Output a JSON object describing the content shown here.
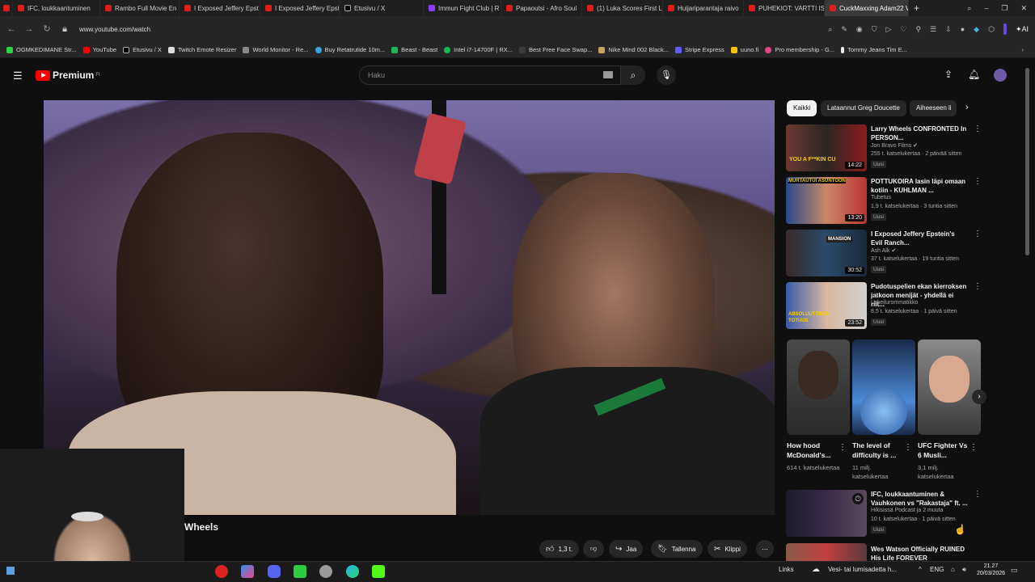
{
  "browser": {
    "tabs": [
      {
        "label": "IFC, loukkaantuminen"
      },
      {
        "label": "Rambo Full Movie En"
      },
      {
        "label": "I Exposed Jeffery Epst"
      },
      {
        "label": "I Exposed Jeffery Epst"
      },
      {
        "label": "Etusivu / X"
      },
      {
        "label": "Immun Fight Club | R"
      },
      {
        "label": "Papaoutsi - Afro Soul"
      },
      {
        "label": "(1) Luka Scores First L"
      },
      {
        "label": "Huijariparantaja raivo"
      },
      {
        "label": "PUHEKIOT: VARTTI IS"
      },
      {
        "label": "CuckMaxxing Adam22 V"
      }
    ],
    "url": "www.youtube.com/watch",
    "ai_label": "AI",
    "bookmarks": [
      {
        "label": "OGMKEDIMANE Str..."
      },
      {
        "label": "YouTube"
      },
      {
        "label": "Etusivu / X"
      },
      {
        "label": "Twitch Emote Resizer"
      },
      {
        "label": "World Monitor - Re..."
      },
      {
        "label": "Buy Retatrutide 10m..."
      },
      {
        "label": "Beast - Beast"
      },
      {
        "label": "Intel i7-14700F | RX..."
      },
      {
        "label": "Best Free Face Swap..."
      },
      {
        "label": "Nike Mind 002 Black..."
      },
      {
        "label": "Stripe Express"
      },
      {
        "label": "uuno.fi"
      },
      {
        "label": "Pro membership - G..."
      },
      {
        "label": "Tommy Jeans Tim E..."
      }
    ]
  },
  "youtube": {
    "logo": "Premium",
    "logo_sup": "FI",
    "search_placeholder": "Haku",
    "video_title": "Wheels",
    "actions": {
      "likes": "1,3 t.",
      "share": "Jaa",
      "save": "Tallenna",
      "clip": "Klippi"
    },
    "chips": [
      "Kaikki",
      "Lataannut Greg Doucette",
      "Aiheeseen li"
    ],
    "recommendations": [
      {
        "title": "Larry Wheels CONFRONTED In PERSON...",
        "channel": "Jon Bravo Films",
        "meta": "255 t. katselukertaa · 2 päivää sitten",
        "badge": "Uusi",
        "duration": "14:22",
        "thumb_text": "YOU A F**KIN CU"
      },
      {
        "title": "POTTUKOIRA lasin läpi omaan kotiin - KUHLMAN ...",
        "channel": "Tubetus",
        "meta": "1,9 t. katselukertaa · 3 tuntia sitten",
        "badge": "Uusi",
        "duration": "13:20",
        "thumb_text": "MURTAUTUI ASUNTOON"
      },
      {
        "title": "I Exposed Jeffery Epstein's Evil Ranch...",
        "channel": "Ash Alk",
        "meta": "37 t. katselukertaa · 19 tuntia sitten",
        "badge": "Uusi",
        "duration": "30:52",
        "thumb_text": "MANSION"
      },
      {
        "title": "Pudotuspelien ekan kierroksen jatkoon menijät - yhdellä ei riit...",
        "channel": "Urheilurommatikko",
        "meta": "8,5 t. katselukertaa · 1 päivä sitten",
        "badge": "Uusi",
        "duration": "23:52",
        "thumb_text": "ABSOLUUTTINEN TOTUUS"
      }
    ],
    "shorts": [
      {
        "title": "How hood McDonald's...",
        "views": "614 t. katselukertaa"
      },
      {
        "title": "The level of difficulty is ...",
        "views": "11 milj. katselukertaa"
      },
      {
        "title": "UFC Fighter Vs 6 Musli...",
        "views": "3,1 milj. katselukertaa"
      }
    ],
    "rec_bottom": [
      {
        "title": "IFC, loukkaantuminen & Vauhkonen vs \"Rakastaja\" ft. ...",
        "channel": "Hikisissä Podcast ja 2 muuta",
        "meta": "10 t. katselukertaa · 1 päivä sitten",
        "badge": "Uusi"
      },
      {
        "title": "Wes Watson Officially RUINED His Life FOREVER",
        "channel": "",
        "meta": "",
        "badge": ""
      }
    ]
  },
  "taskbar": {
    "links": "Links",
    "news": "Vesi- tai lumisadetta h...",
    "lang": "ENG",
    "time": "21.27",
    "date": "20/03/2026"
  },
  "colors": {
    "brand": "#ff0000",
    "bg": "#0f0f0f"
  }
}
